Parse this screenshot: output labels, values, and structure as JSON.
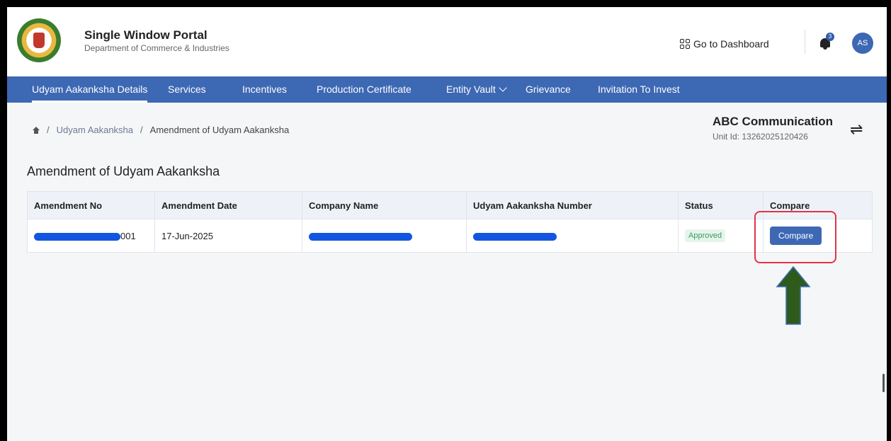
{
  "header": {
    "title": "Single Window Portal",
    "subtitle": "Department of Commerce & Industries",
    "dashboard_label": "Go to Dashboard",
    "notification_count": "3",
    "avatar_initials": "AS"
  },
  "nav": {
    "items": [
      {
        "label": "Udyam Aakanksha Details",
        "active": true
      },
      {
        "label": "Services"
      },
      {
        "label": "Incentives"
      },
      {
        "label": "Production Certificate"
      },
      {
        "label": "Entity Vault",
        "has_dropdown": true
      },
      {
        "label": "Grievance"
      },
      {
        "label": "Invitation To Invest"
      }
    ]
  },
  "breadcrumb": {
    "items": [
      "Udyam Aakanksha",
      "Amendment of Udyam Aakanksha"
    ]
  },
  "unit": {
    "name": "ABC Communication",
    "id_label": "Unit Id: 13262025120426"
  },
  "page_title": "Amendment of Udyam Aakanksha",
  "table": {
    "columns": [
      "Amendment No",
      "Amendment Date",
      "Company Name",
      "Udyam Aakanksha Number",
      "Status",
      "Compare"
    ],
    "rows": [
      {
        "amendment_no_visible": "001",
        "amendment_date": "17-Jun-2025",
        "status": "Approved",
        "compare_label": "Compare"
      }
    ]
  },
  "colors": {
    "nav": "#3d68b3",
    "highlight": "#e23345",
    "arrow": "#2e5a1c",
    "redaction": "#1255e0"
  }
}
